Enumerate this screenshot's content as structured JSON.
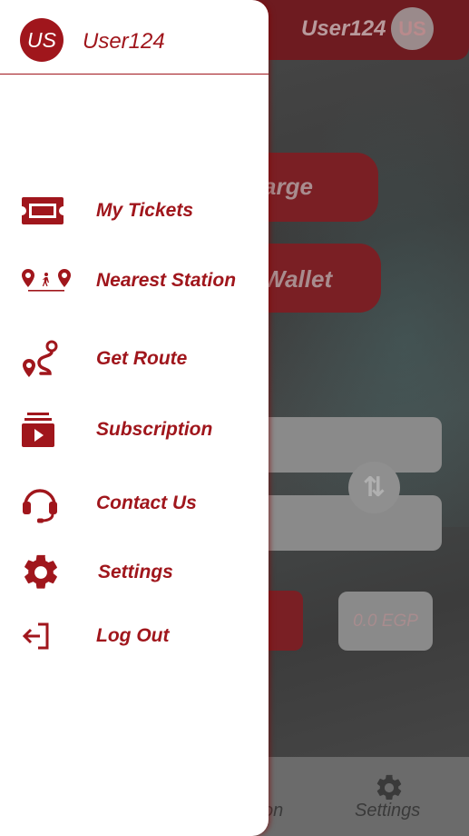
{
  "colors": {
    "brand": "#a0161c",
    "drawer_bg": "#ffffff"
  },
  "background": {
    "username": "User124",
    "avatar_initials": "US",
    "button_recharge": "arge",
    "button_wallet": "Wallet",
    "price": "0.0 EGP",
    "bottom_nav_left": "on",
    "bottom_nav_settings": "Settings"
  },
  "drawer": {
    "avatar_initials": "US",
    "username": "User124",
    "menu": [
      {
        "label": "My Tickets",
        "icon": "ticket-icon"
      },
      {
        "label": "Nearest Station",
        "icon": "nearest-station-icon"
      },
      {
        "label": "Get Route",
        "icon": "route-icon"
      },
      {
        "label": "Subscription",
        "icon": "subscription-icon"
      },
      {
        "label": "Contact Us",
        "icon": "headset-icon"
      },
      {
        "label": "Settings",
        "icon": "gear-icon"
      },
      {
        "label": "Log Out",
        "icon": "logout-icon"
      }
    ]
  }
}
